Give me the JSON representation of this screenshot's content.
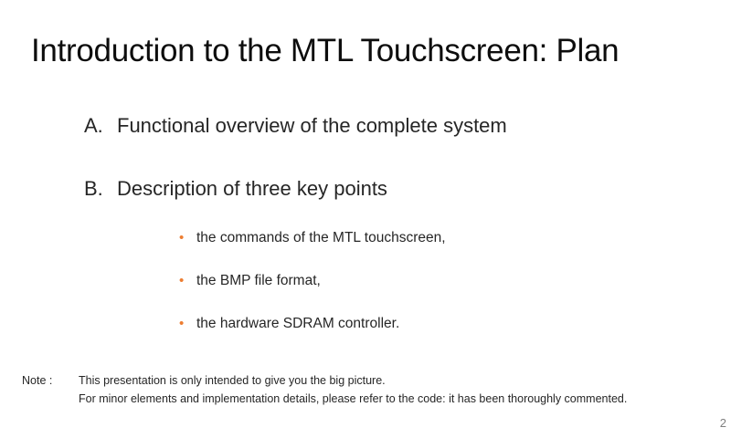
{
  "slide": {
    "title": "Introduction to the MTL Touchscreen: Plan",
    "sections": [
      {
        "letter": "A.",
        "text": "Functional overview of the complete system"
      },
      {
        "letter": "B.",
        "text": "Description of three key points"
      }
    ],
    "bullets": [
      "the commands of the MTL touchscreen,",
      "the BMP file format,",
      "the hardware SDRAM controller."
    ],
    "bullet_glyph": "•",
    "accent_color": "#ed7d31",
    "note": {
      "label": "Note :",
      "lines": [
        "This presentation is only intended to give you the big picture.",
        "For minor elements and implementation details, please refer to the code: it has been thoroughly commented."
      ]
    },
    "page_number": "2"
  }
}
